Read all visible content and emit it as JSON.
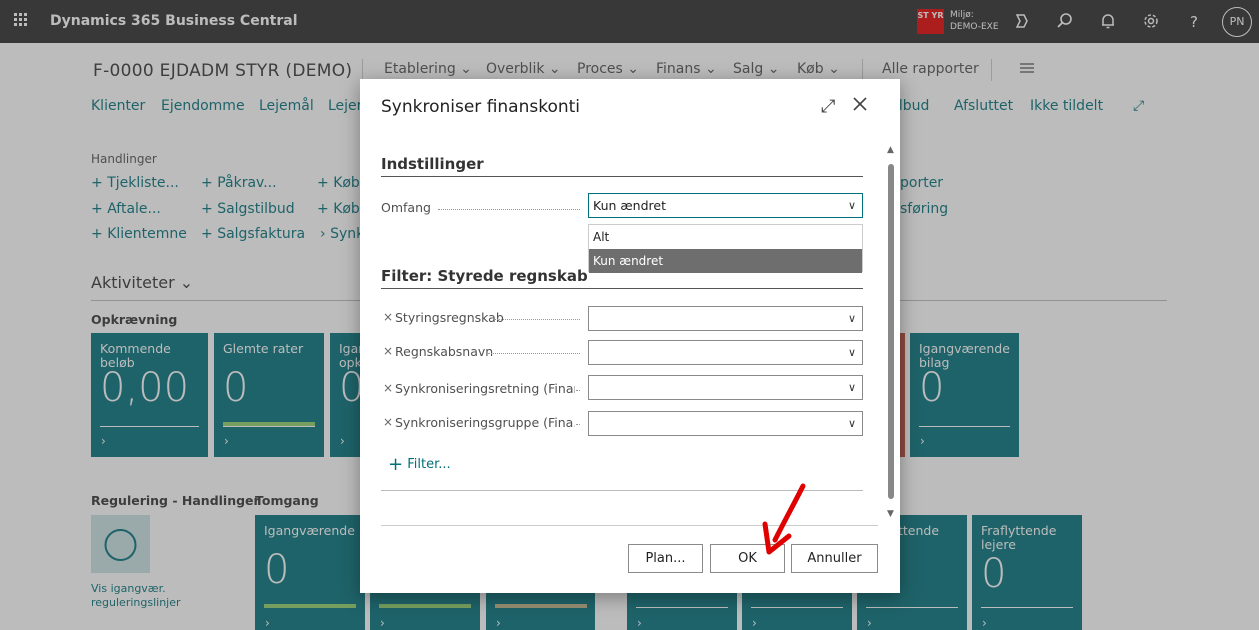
{
  "topbar": {
    "app_title": "Dynamics 365 Business Central",
    "env_badge": "ST YR",
    "env_label": "Miljø:",
    "env_name": "DEMO-EXE",
    "avatar": "PN",
    "help": "?"
  },
  "page": {
    "company": "F-0000 EJDADM STYR (DEMO)",
    "menus": [
      "Etablering",
      "Overblik",
      "Proces",
      "Finans",
      "Salg",
      "Køb"
    ],
    "all_reports": "Alle rapporter",
    "nav_links": [
      "Klienter",
      "Ejendomme",
      "Lejemål",
      "Lejer",
      "ilbud",
      "Afsluttet",
      "Ikke tildelt"
    ],
    "actions_label": "Handlinger",
    "actions": {
      "col1": [
        "Tjekliste...",
        "Aftale...",
        "Klientemne"
      ],
      "col2": [
        "Påkrav...",
        "Salgstilbud",
        "Salgsfaktura"
      ],
      "col3": [
        "Køb",
        "Køb",
        "Synk"
      ],
      "col4": [
        "porter",
        "sføring"
      ]
    },
    "activities_heading": "Aktiviteter",
    "collections_label": "Opkrævning",
    "tiles_row1": [
      {
        "title": "Kommende beløb",
        "value": "0,00"
      },
      {
        "title": "Glemte rater",
        "value": "0"
      },
      {
        "title": "Igan opk",
        "value": "0"
      },
      {
        "title": "Igangværende bilag",
        "value": "0"
      }
    ],
    "regulation_label": "Regulering - Handlinger",
    "regulation_link": "Vis igangvær. reguleringslinjer",
    "tomgang_label": "Tomgang",
    "tiles_row2": [
      {
        "title": "Igangværende",
        "value": "0"
      },
      {
        "title": "",
        "value": ""
      },
      {
        "title": "",
        "value": ""
      },
      {
        "title": "",
        "value": ""
      },
      {
        "title": "",
        "value": ""
      },
      {
        "title": "ttende",
        "value": ""
      },
      {
        "title": "Fraflyttende lejere",
        "value": "0"
      }
    ]
  },
  "dialog": {
    "title": "Synkroniser finanskonti",
    "settings_heading": "Indstillinger",
    "scope_label": "Omfang",
    "scope_value": "Kun ændret",
    "scope_options": [
      "Alt",
      "Kun ændret"
    ],
    "filter_heading": "Filter: Styrede regnskab",
    "filters": [
      {
        "label": "Styringsregnskab",
        "value": ""
      },
      {
        "label": "Regnskabsnavn",
        "value": ""
      },
      {
        "label": "Synkroniseringsretning (Finan...",
        "value": ""
      },
      {
        "label": "Synkroniseringsgruppe (Fina...",
        "value": ""
      }
    ],
    "add_filter": "Filter...",
    "buttons": {
      "plan": "Plan...",
      "ok": "OK",
      "cancel": "Annuller"
    }
  },
  "colors": {
    "accent": "#00707a",
    "topbar": "#2a2a2a",
    "tile": "#00707a",
    "bar_green": "#8fd06a",
    "bar_tan": "#c4b78a",
    "annotation_arrow": "#e00000"
  }
}
